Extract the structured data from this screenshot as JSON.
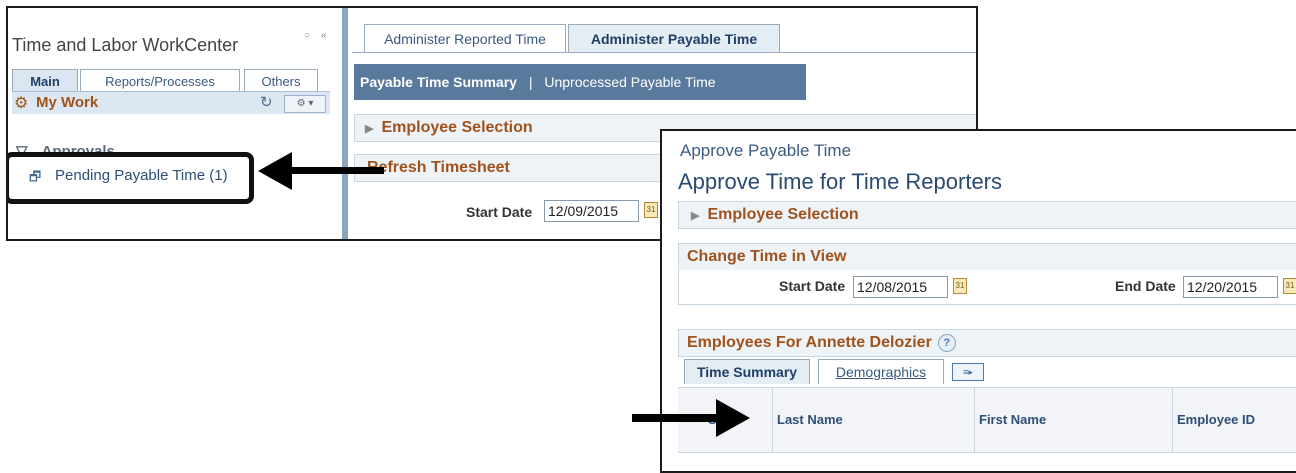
{
  "workcenter": {
    "title": "Time and Labor WorkCenter",
    "window_controls": "○ «",
    "tabs": [
      "Main",
      "Reports/Processes",
      "Others"
    ],
    "my_work_label": "My Work",
    "refresh_icon": "↻",
    "gear_menu": "⚙ ▾",
    "approvals_label": "Approvals",
    "approvals_toggle": "▽",
    "pending_item": "Pending Payable Time (1)"
  },
  "right_panel": {
    "tabs": [
      "Administer Reported Time",
      "Administer Payable Time"
    ],
    "pagelet_bar": {
      "link1": "Payable Time Summary",
      "separator": "|",
      "link2": "Unprocessed Payable Time"
    },
    "employee_selection": "Employee Selection",
    "refresh_timesheet": "Refresh Timesheet",
    "start_date_label": "Start Date",
    "start_date_value": "12/09/2015",
    "calendar_glyph": "31"
  },
  "approve_page": {
    "breadcrumb": "Approve Payable Time",
    "title": "Approve Time for Time Reporters",
    "employee_selection": "Employee Selection",
    "change_time_in_view": "Change Time in View",
    "start_date_label": "Start Date",
    "start_date_value": "12/08/2015",
    "end_date_label": "End Date",
    "end_date_value": "12/20/2015",
    "calendar_glyph": "31",
    "employees_for": "Employees For Annette Delozier",
    "help_glyph": "?",
    "tabs": [
      "Time Summary",
      "Demographics"
    ],
    "grid_icon_glyph": "≡▸",
    "columns": [
      "S",
      "Last Name",
      "First Name",
      "Employee ID"
    ]
  },
  "colors": {
    "section_text": "#a0521a",
    "pagelet_bar": "#5a7a9d",
    "link_blue": "#2d4f78"
  }
}
